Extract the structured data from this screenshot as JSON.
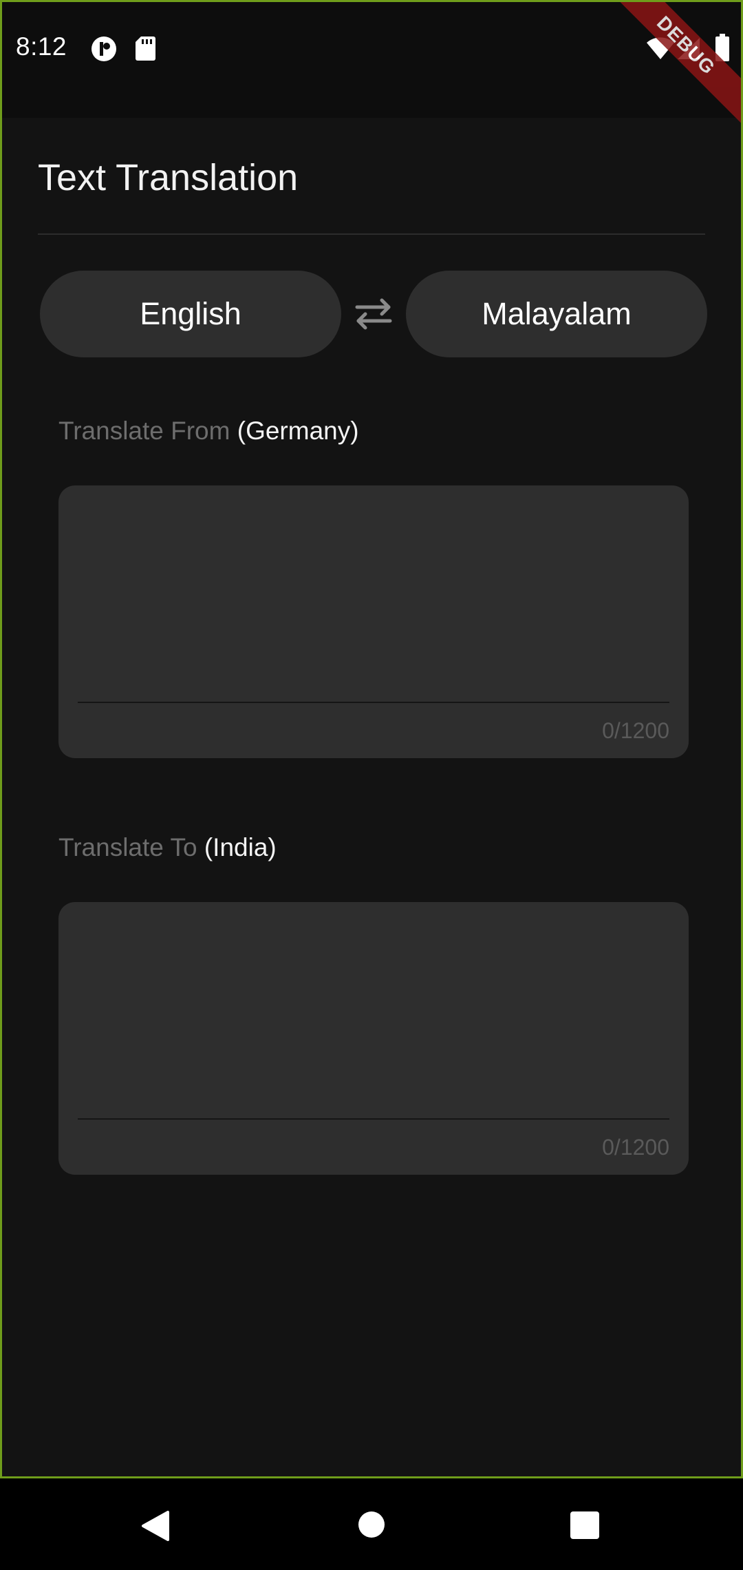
{
  "status_bar": {
    "time": "8:12",
    "icons": [
      "app-notification-icon",
      "sd-card-icon",
      "wifi-icon",
      "signal-icon",
      "battery-icon"
    ]
  },
  "debug_banner": "DEBUG",
  "header": {
    "title": "Text Translation"
  },
  "languages": {
    "from": "English",
    "to": "Malayalam",
    "swap_icon": "swap-arrows-icon"
  },
  "source": {
    "label_prefix": "Translate From",
    "label_region": "(Germany)",
    "value": "",
    "counter": "0/1200"
  },
  "target": {
    "label_prefix": "Translate To",
    "label_region": "(India)",
    "value": "",
    "counter": "0/1200"
  },
  "nav_bar": {
    "icons": [
      "back-icon",
      "home-icon",
      "recents-icon"
    ]
  },
  "colors": {
    "background": "#131313",
    "surface": "#2e2e2e",
    "muted_text": "#6d6d6d",
    "frame_border": "#6f9d1b",
    "debug_banner": "#8a1515"
  }
}
